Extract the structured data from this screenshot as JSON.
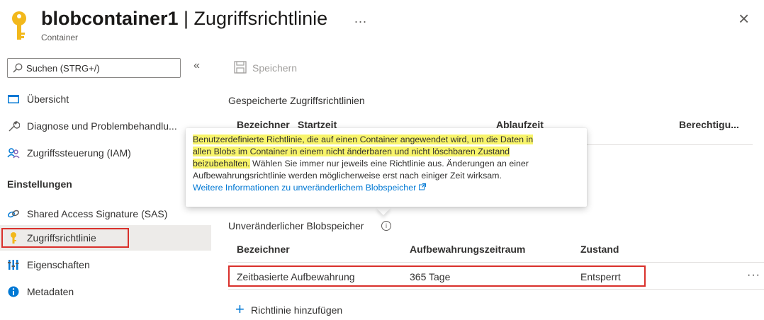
{
  "header": {
    "title_bold": "blobcontainer1",
    "title_rest": " | Zugriffsrichtlinie",
    "subtitle": "Container",
    "more": "...",
    "close": "×"
  },
  "sidebar": {
    "search_placeholder": "Suchen (STRG+/)",
    "collapse": "«",
    "items": [
      {
        "label": "Übersicht",
        "icon": "overview-icon"
      },
      {
        "label": "Diagnose und Problembehandlu...",
        "icon": "wrench-icon"
      },
      {
        "label": "Zugriffssteuerung (IAM)",
        "icon": "people-icon"
      }
    ],
    "section_settings": "Einstellungen",
    "settings_items": [
      {
        "label": "Shared Access Signature (SAS)",
        "icon": "link-icon"
      },
      {
        "label": "Zugriffsrichtlinie",
        "icon": "key-icon",
        "active": true
      },
      {
        "label": "Eigenschaften",
        "icon": "properties-icon"
      },
      {
        "label": "Metadaten",
        "icon": "info-icon"
      }
    ]
  },
  "toolbar": {
    "save_label": "Speichern"
  },
  "saved_policies": {
    "title": "Gespeicherte Zugriffsrichtlinien",
    "columns": [
      "Bezeichner",
      "Startzeit",
      "Ablaufzeit",
      "Berechtigu..."
    ]
  },
  "tooltip": {
    "highlighted": "Benutzerdefinierte Richtlinie, die auf einen Container angewendet wird, um die Daten in allen Blobs im Container in einem nicht änderbaren und nicht löschbaren Zustand beizubehalten.",
    "highlighted_line1": "Benutzerdefinierte Richtlinie, die auf einen Container angewendet wird, um die Daten in",
    "highlighted_line2": "allen Blobs im Container in einem nicht änderbaren und nicht löschbaren Zustand",
    "highlighted_line3": "beizubehalten.",
    "rest_line3": " Wählen Sie immer nur jeweils eine Richtlinie aus. Änderungen an einer",
    "rest_line4": "Aufbewahrungsrichtlinie werden möglicherweise erst nach einiger Zeit wirksam.",
    "link": "Weitere Informationen zu unveränderlichem Blobspeicher"
  },
  "immutable": {
    "title": "Unveränderlicher Blobspeicher",
    "columns": [
      "Bezeichner",
      "Aufbewahrungszeitraum",
      "Zustand"
    ],
    "rows": [
      {
        "name": "Zeitbasierte Aufbewahrung",
        "period": "365 Tage",
        "state": "Entsperrt"
      }
    ],
    "row_more": "···"
  },
  "add_policy": {
    "label": "Richtlinie hinzufügen"
  },
  "colors": {
    "accent": "#0078d4",
    "highlight": "#f8f46a",
    "red_box": "#d9302b",
    "key": "#f2b81c"
  }
}
